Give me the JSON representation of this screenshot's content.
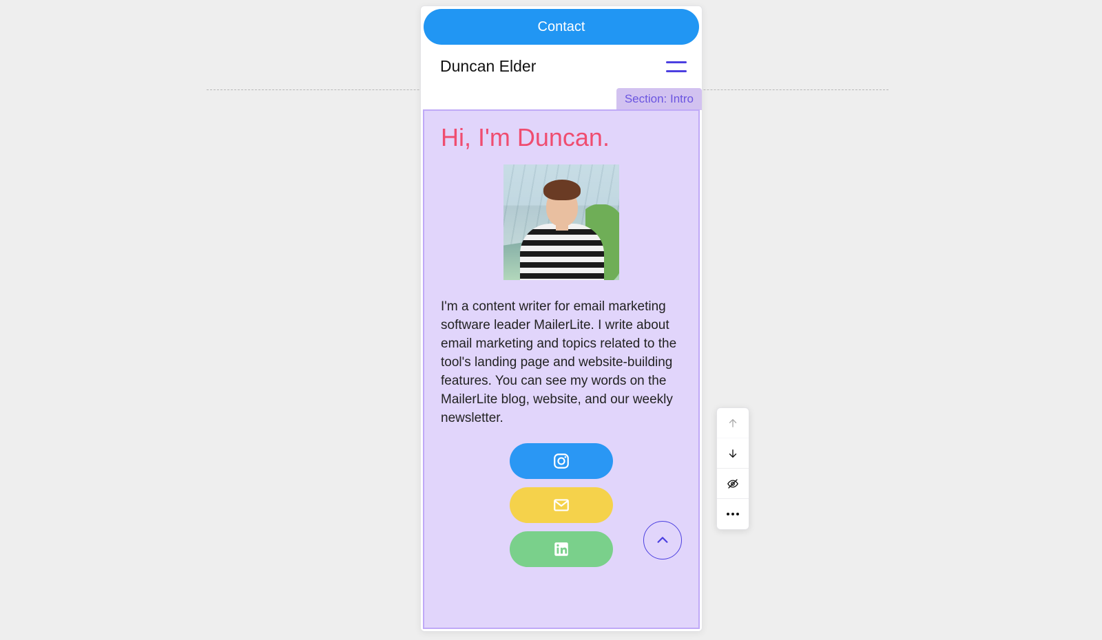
{
  "contact_button": "Contact",
  "site_title": "Duncan Elder",
  "section_badge": "Section: Intro",
  "intro_heading": "Hi, I'm Duncan.",
  "intro_text": "I'm a content writer for email marketing software leader MailerLite. I write about email marketing and topics related to the tool's landing page and website-building features. You can see my words on the MailerLite blog, website, and our weekly newsletter.",
  "social": {
    "instagram": "instagram-icon",
    "email": "mail-icon",
    "linkedin": "linkedin-icon"
  },
  "toolbar": {
    "move_up": "move-section-up",
    "move_down": "move-section-down",
    "visibility": "toggle-visibility",
    "more": "more-options"
  },
  "colors": {
    "accent_blue": "#2196f3",
    "accent_purple": "#e1d5fb",
    "heading_pink": "#ef4d70",
    "outline_indigo": "#4b3fe0"
  }
}
